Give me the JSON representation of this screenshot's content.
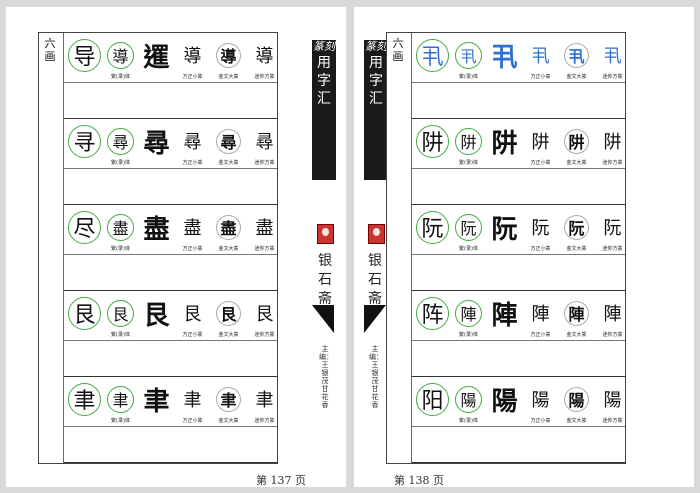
{
  "book": {
    "spine_seal": "篆刻",
    "spine_title": "用字汇",
    "studio": "银石斋",
    "editors": "主编：王银茂　甘花香"
  },
  "captions": [
    "繁(录)体",
    "方正小篆",
    "金文大篆",
    "迷你方篆"
  ],
  "pages": [
    {
      "stroke_label": "六画",
      "page_number": "第 137 页",
      "rows": [
        {
          "chars": [
            "导",
            "導",
            "𨗴",
            "導",
            "導",
            "導"
          ]
        },
        {
          "chars": [
            "寻",
            "尋",
            "尋",
            "尋",
            "尋",
            "尋"
          ]
        },
        {
          "chars": [
            "尽",
            "盡",
            "盡",
            "盡",
            "盡",
            "盡"
          ]
        },
        {
          "chars": [
            "艮",
            "艮",
            "艮",
            "艮",
            "艮",
            "艮"
          ]
        },
        {
          "chars": [
            "聿",
            "聿",
            "聿",
            "聿",
            "聿",
            "聿"
          ]
        }
      ]
    },
    {
      "stroke_label": "六画",
      "page_number": "第 138 页",
      "rows": [
        {
          "chars": [
            "丮",
            "丮",
            "丮",
            "丮",
            "丮",
            "丮"
          ],
          "blue": true
        },
        {
          "chars": [
            "阱",
            "阱",
            "阱",
            "阱",
            "阱",
            "阱"
          ]
        },
        {
          "chars": [
            "阮",
            "阮",
            "阮",
            "阮",
            "阮",
            "阮"
          ]
        },
        {
          "chars": [
            "阵",
            "陣",
            "陣",
            "陣",
            "陣",
            "陣"
          ]
        },
        {
          "chars": [
            "阳",
            "陽",
            "陽",
            "陽",
            "陽",
            "陽"
          ]
        }
      ]
    }
  ],
  "colors": {
    "ring": "#44aa44",
    "highlight": "#2f6fd0",
    "spine": "#1a1a1a"
  }
}
